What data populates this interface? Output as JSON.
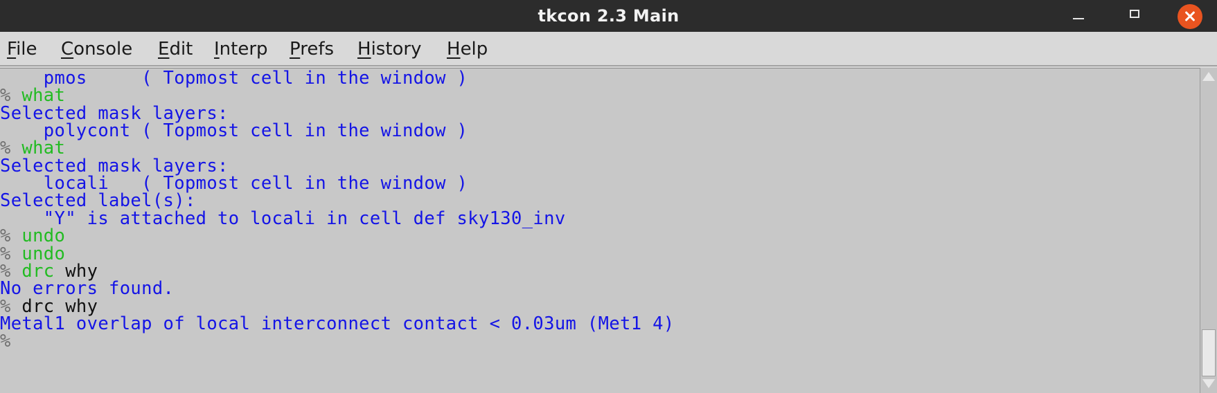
{
  "window": {
    "title": "tkcon 2.3 Main",
    "close_color": "#e95420"
  },
  "menu": [
    {
      "mnemonic": "F",
      "rest": "ile"
    },
    {
      "mnemonic": "C",
      "rest": "onsole"
    },
    {
      "mnemonic": "E",
      "rest": "dit"
    },
    {
      "mnemonic": "I",
      "rest": "nterp"
    },
    {
      "mnemonic": "P",
      "rest": "refs"
    },
    {
      "mnemonic": "H",
      "rest": "istory"
    },
    {
      "mnemonic": "H",
      "rest": "elp"
    }
  ],
  "console": {
    "colors": {
      "output": "#1414e6",
      "command": "#22bb22",
      "error_command": "#111111",
      "prompt": "#707070"
    },
    "lines": [
      {
        "prompt": "",
        "segments": [
          {
            "text": "    pmos     ( Topmost cell in the window )",
            "style": "output"
          }
        ]
      },
      {
        "prompt": "% ",
        "segments": [
          {
            "text": "what",
            "style": "command"
          }
        ]
      },
      {
        "prompt": "",
        "segments": [
          {
            "text": "Selected mask layers:",
            "style": "output"
          }
        ]
      },
      {
        "prompt": "",
        "segments": [
          {
            "text": "    polycont ( Topmost cell in the window )",
            "style": "output"
          }
        ]
      },
      {
        "prompt": "% ",
        "segments": [
          {
            "text": "what",
            "style": "command"
          }
        ]
      },
      {
        "prompt": "",
        "segments": [
          {
            "text": "Selected mask layers:",
            "style": "output"
          }
        ]
      },
      {
        "prompt": "",
        "segments": [
          {
            "text": "    locali   ( Topmost cell in the window )",
            "style": "output"
          }
        ]
      },
      {
        "prompt": "",
        "segments": [
          {
            "text": "Selected label(s):",
            "style": "output"
          }
        ]
      },
      {
        "prompt": "",
        "segments": [
          {
            "text": "    \"Y\" is attached to locali in cell def sky130_inv",
            "style": "output"
          }
        ]
      },
      {
        "prompt": "% ",
        "segments": [
          {
            "text": "undo",
            "style": "command"
          }
        ]
      },
      {
        "prompt": "% ",
        "segments": [
          {
            "text": "undo",
            "style": "command"
          }
        ]
      },
      {
        "prompt": "% ",
        "segments": [
          {
            "text": "drc",
            "style": "command"
          },
          {
            "text": " why",
            "style": "error_command"
          }
        ]
      },
      {
        "prompt": "",
        "segments": [
          {
            "text": "No errors found.",
            "style": "output"
          }
        ]
      },
      {
        "prompt": "% ",
        "segments": [
          {
            "text": "drc why",
            "style": "error_command"
          }
        ]
      },
      {
        "prompt": "",
        "segments": [
          {
            "text": "Metal1 overlap of local interconnect contact < 0.03um (Met1 4)",
            "style": "output"
          }
        ]
      },
      {
        "prompt": "%",
        "segments": []
      }
    ]
  }
}
